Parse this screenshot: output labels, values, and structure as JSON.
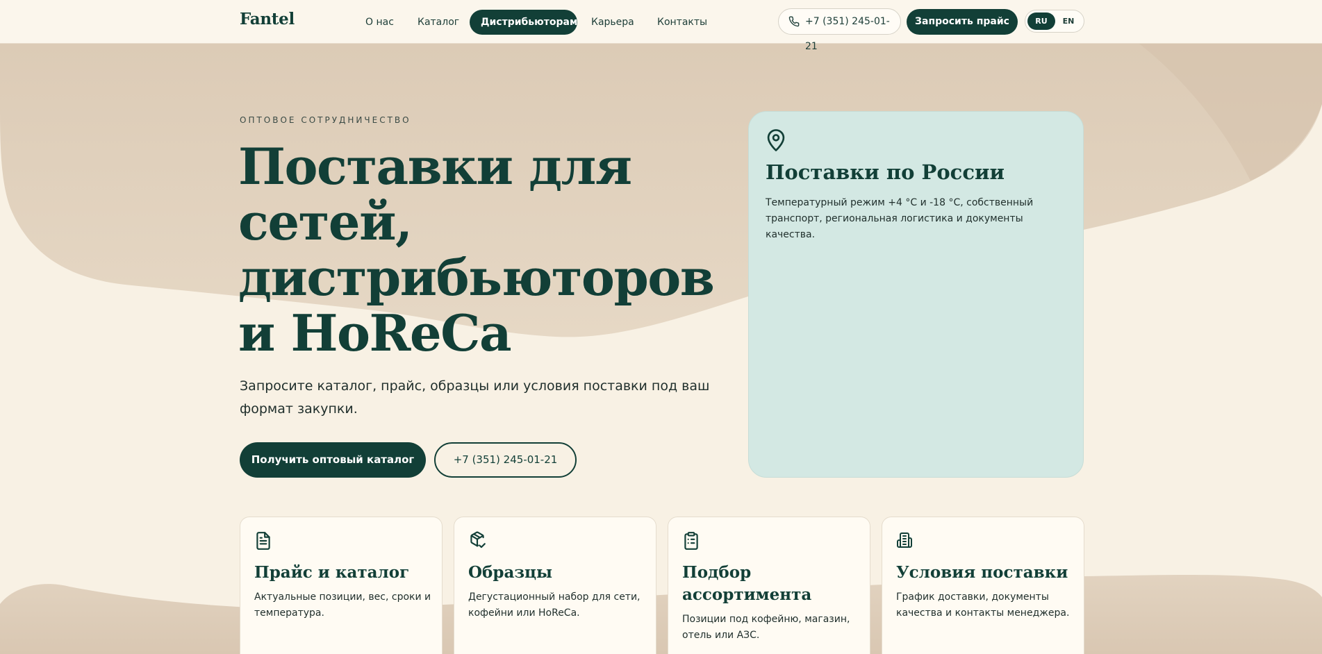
{
  "header": {
    "logo": "Fantel",
    "nav": [
      "О нас",
      "Каталог",
      "Дистрибьюторам",
      "Карьера",
      "Контакты"
    ],
    "active_nav": "Дистрибьюторам",
    "phone": "+7 (351) 245-01-21",
    "price_button": "Запросить прайс",
    "lang_ru": "RU",
    "lang_en": "EN",
    "active_lang": "RU"
  },
  "hero": {
    "eyebrow": "ОПТОВОЕ СОТРУДНИЧЕСТВО",
    "title_line1": "Поставки для",
    "title_line2": "сетей,",
    "title_line3": "дистрибьюторов",
    "title_line4": "и HoReCa",
    "subtitle": "Запросите каталог, прайс, образцы или условия поставки под ваш формат закупки.",
    "primary_button": "Получить оптовый каталог",
    "phone_button": "+7 (351) 245-01-21"
  },
  "delivery_card": {
    "icon": "map-pin-icon",
    "title": "Поставки по России",
    "text": "Температурный режим +4 °C и -18 °C, собственный транспорт, региональная логистика и документы качества."
  },
  "features": [
    {
      "icon": "document-icon",
      "title": "Прайс и каталог",
      "text": "Актуальные позиции, вес, сроки и температура."
    },
    {
      "icon": "package-check-icon",
      "title": "Образцы",
      "text": "Дегустационный набор для сети, кофейни или HoReCa."
    },
    {
      "icon": "clipboard-list-icon",
      "title": "Подбор ассортимента",
      "text": "Позиции под кофейню, магазин, отель или АЗС."
    },
    {
      "icon": "building-icon",
      "title": "Условия поставки",
      "text": "График доставки, документы качества и контакты менеджера."
    }
  ],
  "colors": {
    "brand": "#123f37",
    "background": "#f8f1e4",
    "accent_card": "#d3e8e3",
    "wave": "#d9c7b3"
  }
}
